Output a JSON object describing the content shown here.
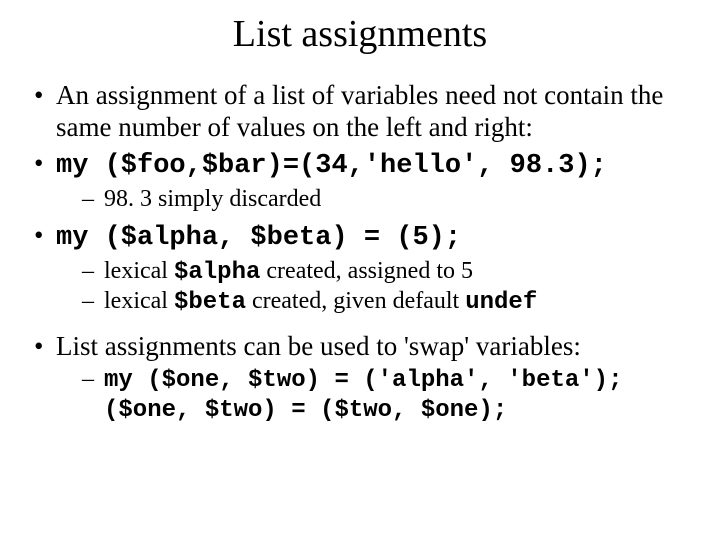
{
  "title": "List assignments",
  "b1": {
    "text": "An assignment of a list of variables need not contain the same number of values on the left and right:"
  },
  "b2": {
    "code": "my ($foo,$bar)=(34,'hello', 98.3);"
  },
  "b2sub1": "98. 3 simply discarded",
  "b3": {
    "code": "my ($alpha, $beta) = (5);"
  },
  "b3sub1": {
    "pre": "lexical ",
    "code": "$alpha",
    "post": " created, assigned to 5"
  },
  "b3sub2": {
    "pre": "lexical ",
    "code1": "$beta",
    "mid": " created, given default ",
    "code2": "undef"
  },
  "b4": "List assignments can be used to 'swap' variables:",
  "b4sub1": {
    "line1": "my ($one, $two) = ('alpha', 'beta');",
    "line2": "($one, $two) = ($two, $one);"
  }
}
